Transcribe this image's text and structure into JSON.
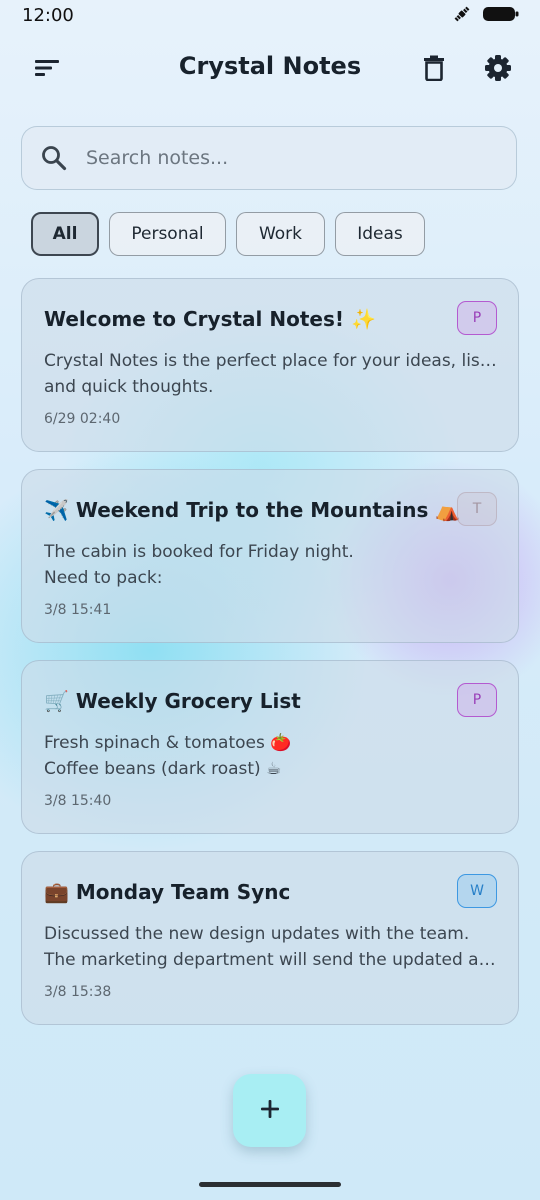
{
  "status_bar": {
    "time": "12:00",
    "icons": [
      "satellite-icon",
      "battery-icon"
    ]
  },
  "header": {
    "title": "Crystal Notes",
    "icons": [
      "sort-menu-icon",
      "trash-icon",
      "gear-icon"
    ]
  },
  "search": {
    "placeholder": "Search notes...",
    "value": "",
    "icon": "search-icon"
  },
  "filters": {
    "selected": "All",
    "items": [
      "All",
      "Personal",
      "Work",
      "Ideas"
    ]
  },
  "notes": [
    {
      "title": "Welcome to Crystal Notes! ✨",
      "lines": [
        "Crystal Notes is the perfect place for your ideas, lists,",
        "and quick thoughts."
      ],
      "date": "6/29 02:40",
      "badge": "P",
      "badge_color": "#b45ad0"
    },
    {
      "title": "✈️ Weekend Trip to the Mountains ⛺",
      "lines": [
        "The cabin is booked for Friday night.",
        "Need to pack:"
      ],
      "date": "3/8 15:41",
      "badge": "T",
      "badge_color": "#b09aa6"
    },
    {
      "title": "🛒 Weekly Grocery List",
      "lines": [
        "Fresh spinach & tomatoes 🍅",
        "Coffee beans (dark roast) ☕"
      ],
      "date": "3/8 15:40",
      "badge": "P",
      "badge_color": "#b45ad0"
    },
    {
      "title": "💼 Monday Team Sync",
      "lines": [
        "Discussed the new design updates with the team.",
        "The marketing department will send the updated as..."
      ],
      "date": "3/8 15:38",
      "badge": "W",
      "badge_color": "#3d98e2"
    }
  ],
  "fab": {
    "icon": "plus-icon",
    "label": "+"
  },
  "colors": {
    "fab_background": "#a8eef3",
    "accent_purple": "#b45ad0",
    "accent_blue": "#3d98e2"
  }
}
